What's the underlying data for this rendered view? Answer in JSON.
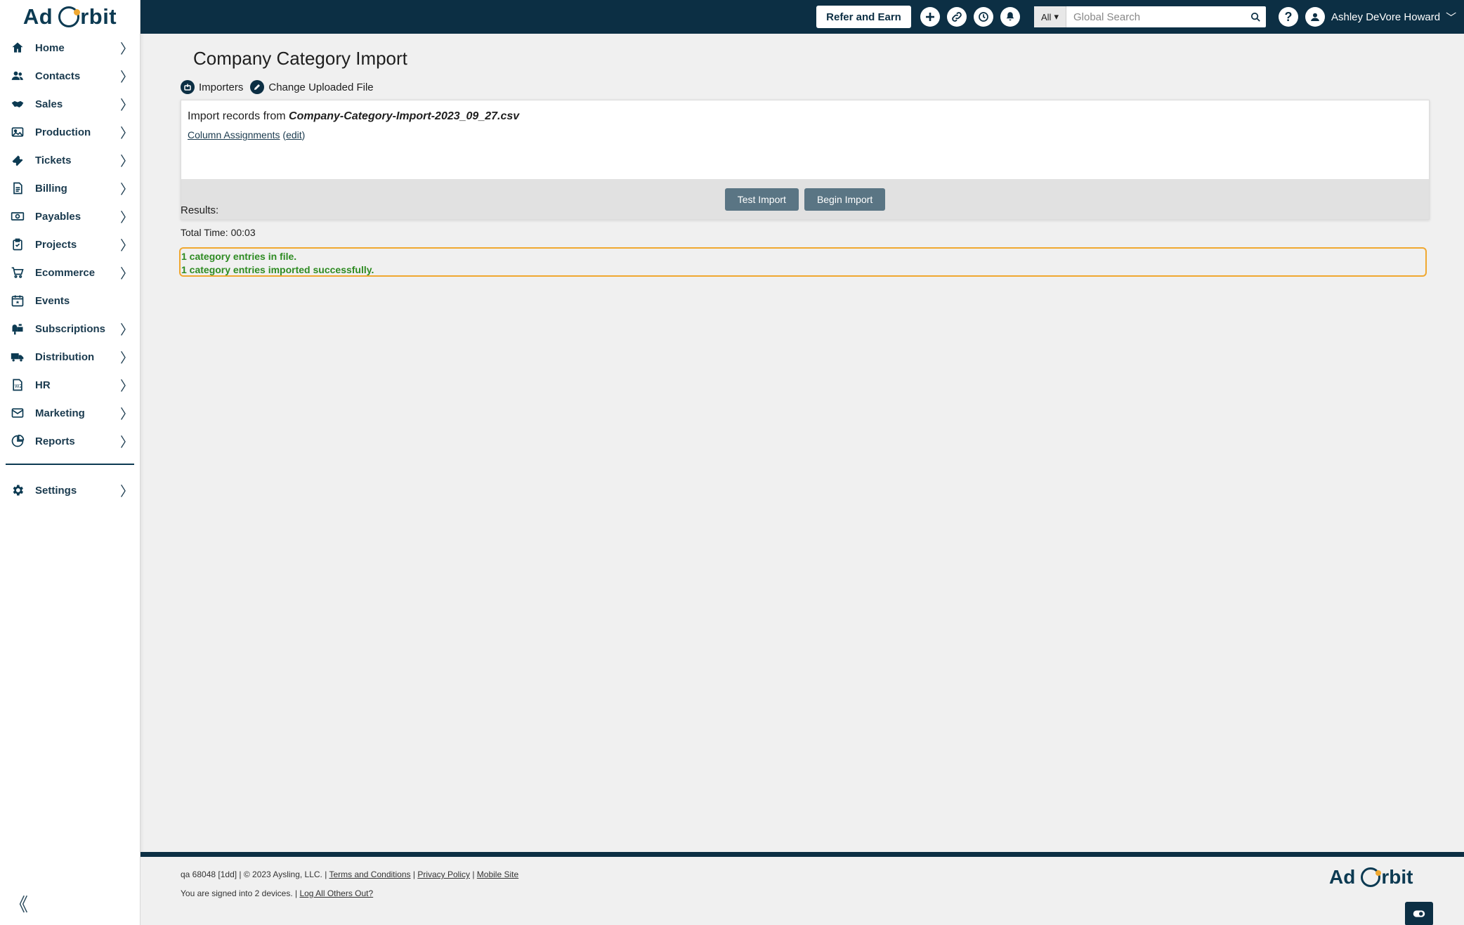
{
  "app": {
    "logo_text_left": "Ad",
    "logo_text_right": "rbit",
    "brand_color": "#0c2f44",
    "accent_color": "#f0a830"
  },
  "sidebar": {
    "items": [
      {
        "label": "Home",
        "icon": "home-icon",
        "has_chevron": true
      },
      {
        "label": "Contacts",
        "icon": "contacts-icon",
        "has_chevron": true
      },
      {
        "label": "Sales",
        "icon": "handshake-icon",
        "has_chevron": true
      },
      {
        "label": "Production",
        "icon": "image-icon",
        "has_chevron": true
      },
      {
        "label": "Tickets",
        "icon": "ticket-icon",
        "has_chevron": true
      },
      {
        "label": "Billing",
        "icon": "invoice-icon",
        "has_chevron": true
      },
      {
        "label": "Payables",
        "icon": "money-icon",
        "has_chevron": true
      },
      {
        "label": "Projects",
        "icon": "clipboard-icon",
        "has_chevron": true
      },
      {
        "label": "Ecommerce",
        "icon": "cart-icon",
        "has_chevron": true
      },
      {
        "label": "Events",
        "icon": "calendar-icon",
        "has_chevron": false
      },
      {
        "label": "Subscriptions",
        "icon": "mailbox-icon",
        "has_chevron": true
      },
      {
        "label": "Distribution",
        "icon": "truck-icon",
        "has_chevron": true
      },
      {
        "label": "HR",
        "icon": "w2-form-icon",
        "has_chevron": true
      },
      {
        "label": "Marketing",
        "icon": "envelope-icon",
        "has_chevron": true
      },
      {
        "label": "Reports",
        "icon": "chart-icon",
        "has_chevron": true
      }
    ],
    "settings": {
      "label": "Settings",
      "icon": "gear-icon",
      "has_chevron": true
    },
    "chevron_glyph": "〉",
    "collapse_glyph": "《"
  },
  "topbar": {
    "refer_label": "Refer and Earn",
    "search_scope": "All",
    "search_placeholder": "Global Search",
    "help_glyph": "?",
    "user_name": "Ashley DeVore Howard"
  },
  "page": {
    "title": "Company Category Import",
    "toolbar": {
      "importers_label": "Importers",
      "change_file_label": "Change Uploaded File"
    },
    "import": {
      "prefix": "Import records from ",
      "filename": "Company-Category-Import-2023_09_27.csv",
      "assignments_label": "Column Assignments",
      "edit_label": "edit"
    },
    "buttons": {
      "test_label": "Test Import",
      "begin_label": "Begin Import"
    },
    "results_label": "Results:",
    "total_time": "Total Time: 00:03",
    "result_lines": [
      "1 category entries in file.",
      "1 category entries imported successfully."
    ]
  },
  "footer": {
    "build_info": "qa 68048 [1dd] | © 2023 Aysling, LLC. | ",
    "terms_label": "Terms and Conditions",
    "privacy_label": "Privacy Policy",
    "mobile_label": "Mobile Site",
    "separator": " | ",
    "signed_in_text": "You are signed into 2 devices. | ",
    "log_out_label": "Log All Others Out?"
  }
}
